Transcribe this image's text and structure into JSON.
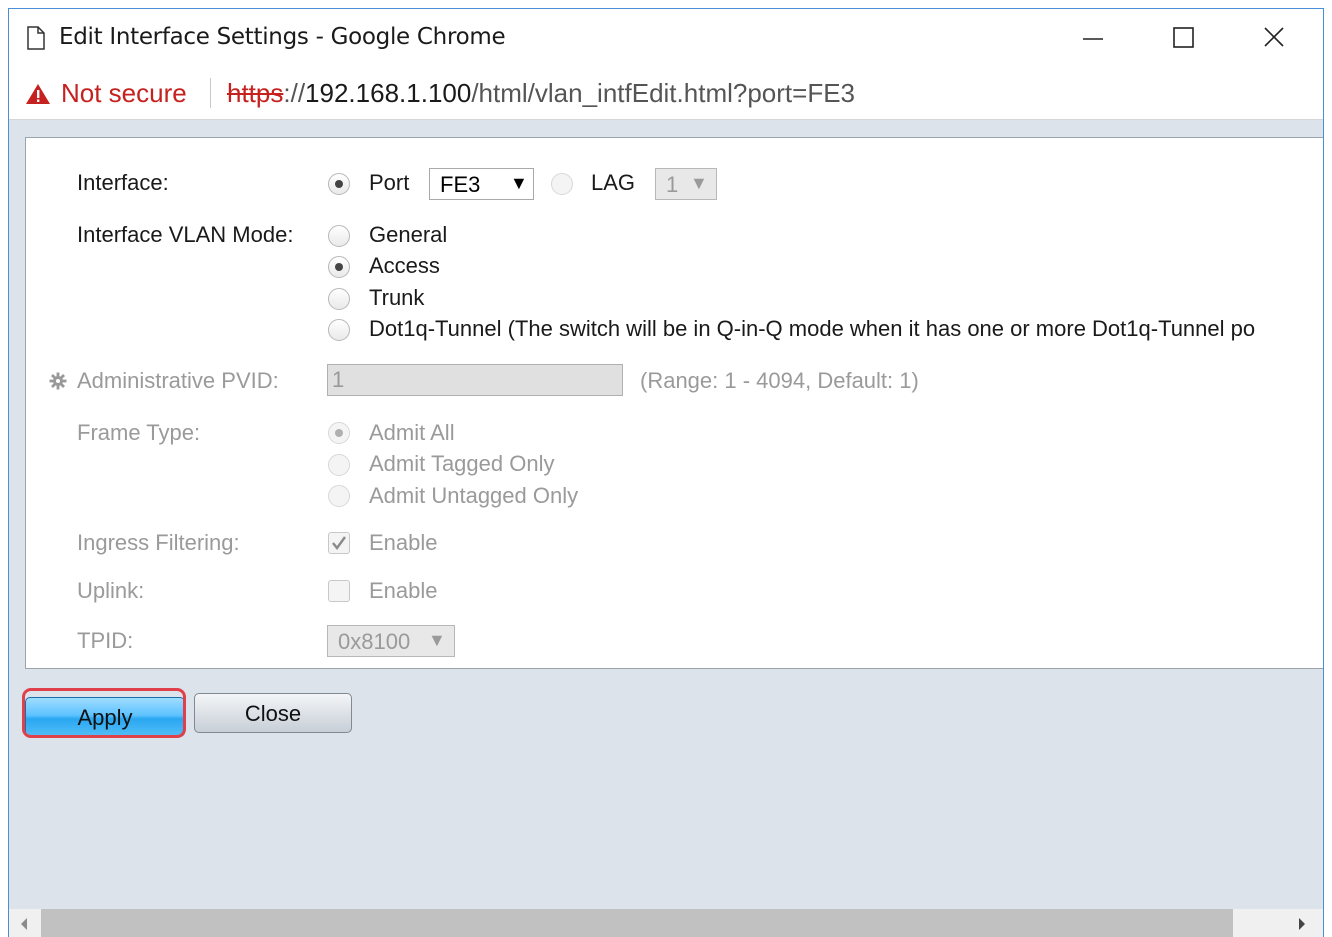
{
  "window": {
    "title": "Edit Interface Settings - Google Chrome",
    "minimize_glyph": "—",
    "maximize_glyph": "☐",
    "close_glyph": "✕"
  },
  "addressbar": {
    "security_label": "Not secure",
    "url_scheme": "https",
    "url_sep": "://",
    "url_host": "192.168.1.100",
    "url_path": "/html/vlan_intfEdit.html?port=FE3",
    "warning_icon": "warning-triangle-icon"
  },
  "form": {
    "interface": {
      "label": "Interface:",
      "port_label": "Port",
      "port_value": "FE3",
      "lag_label": "LAG",
      "lag_value": "1",
      "selected": "Port"
    },
    "vlan_mode": {
      "label": "Interface VLAN Mode:",
      "options": [
        "General",
        "Access",
        "Trunk",
        "Dot1q-Tunnel (The switch will be in Q-in-Q mode when it has one or more Dot1q-Tunnel po"
      ],
      "selected": "Access"
    },
    "pvid": {
      "label": "Administrative PVID:",
      "value": "1",
      "hint": "(Range: 1 - 4094, Default: 1)",
      "icon": "gear-icon"
    },
    "frame_type": {
      "label": "Frame Type:",
      "options": [
        "Admit All",
        "Admit Tagged Only",
        "Admit Untagged Only"
      ],
      "selected": "Admit All"
    },
    "ingress": {
      "label": "Ingress Filtering:",
      "checkbox_label": "Enable",
      "checked": true
    },
    "uplink": {
      "label": "Uplink:",
      "checkbox_label": "Enable",
      "checked": false
    },
    "tpid": {
      "label": "TPID:",
      "value": "0x8100"
    }
  },
  "buttons": {
    "apply": "Apply",
    "close": "Close"
  },
  "colors": {
    "not_secure_red": "#c5221f",
    "highlight_red": "#e0404a",
    "apply_blue": "#2aa7f0"
  }
}
